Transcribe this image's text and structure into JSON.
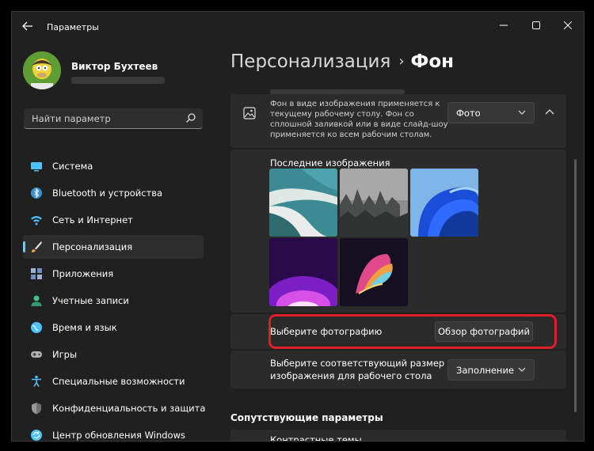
{
  "window": {
    "title": "Параметры",
    "controls": [
      "minimize-icon",
      "maximize-icon",
      "close-icon"
    ]
  },
  "user": {
    "name": "Виктор Бухтеев"
  },
  "search": {
    "placeholder": "Найти параметр"
  },
  "sidebar": {
    "items": [
      {
        "label": "Система",
        "icon": "system-icon",
        "color": "#4cc2ff"
      },
      {
        "label": "Bluetooth и устройства",
        "icon": "bluetooth-icon",
        "color": "#4cc2ff"
      },
      {
        "label": "Сеть и Интернет",
        "icon": "network-icon",
        "color": "#4cc2ff"
      },
      {
        "label": "Персонализация",
        "icon": "brush-icon",
        "color": "#f0a050",
        "active": true
      },
      {
        "label": "Приложения",
        "icon": "apps-icon",
        "color": "#9ab4d8"
      },
      {
        "label": "Учетные записи",
        "icon": "account-icon",
        "color": "#3cc48c"
      },
      {
        "label": "Время и язык",
        "icon": "globe-icon",
        "color": "#4cc2ff"
      },
      {
        "label": "Игры",
        "icon": "gamepad-icon",
        "color": "#b0b0b0"
      },
      {
        "label": "Специальные возможности",
        "icon": "accessibility-icon",
        "color": "#4cc2ff"
      },
      {
        "label": "Конфиденциальность и защита",
        "icon": "shield-icon",
        "color": "#9a9a9a"
      },
      {
        "label": "Центр обновления Windows",
        "icon": "update-icon",
        "color": "#4cc2ff"
      }
    ]
  },
  "breadcrumb": {
    "parent": "Персонализация",
    "separator": "›",
    "current": "Фон"
  },
  "background": {
    "description_lines": [
      "Фон в виде изображения применяется к",
      "текущему рабочему столу. Фон со",
      "сплошной заливкой или в виде слайд-шоу",
      "применяется ко всем рабочим столам."
    ],
    "type_dropdown": "Фото",
    "recent_title": "Последние изображения",
    "recent_images": [
      "coast-aerial",
      "misty-forest",
      "blue-bloom",
      "purple-glow",
      "colorful-ribbon"
    ],
    "choose_photo_label": "Выберите фотографию",
    "browse_button": "Обзор фотографий",
    "fit_label_lines": [
      "Выберите соответствующий размер",
      "изображения для рабочего стола"
    ],
    "fit_dropdown": "Заполнение"
  },
  "related": {
    "title": "Сопутствующие параметры",
    "items": [
      "Контрастные темы"
    ]
  },
  "colors": {
    "accent": "#60cdff",
    "highlight": "#e01e27"
  }
}
